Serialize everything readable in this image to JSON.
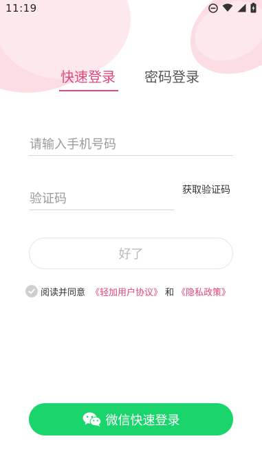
{
  "status_bar": {
    "time": "11:19",
    "icons": [
      "do-not-disturb-icon",
      "wifi-icon",
      "signal-icon",
      "battery-icon"
    ]
  },
  "tabs": [
    {
      "label": "快速登录",
      "active": true
    },
    {
      "label": "密码登录",
      "active": false
    }
  ],
  "form": {
    "phone_placeholder": "请输入手机号码",
    "phone_value": "",
    "code_placeholder": "验证码",
    "code_value": "",
    "get_code_label": "获取验证码",
    "confirm_label": "好了"
  },
  "agreement": {
    "prefix": "阅读并同意",
    "user_agreement": "《轻加用户协议》",
    "and": "和",
    "privacy_policy": "《隐私政策》",
    "checked": false
  },
  "wechat": {
    "label": "微信快速登录"
  },
  "colors": {
    "accent": "#e6447a",
    "wechat_green": "#1ad56b",
    "blob_pink": "#fbdde3",
    "muted_text": "#9a9a9a"
  }
}
